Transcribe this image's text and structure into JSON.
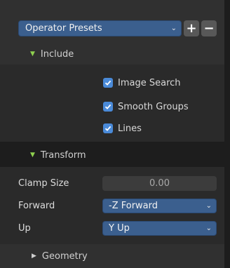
{
  "presets": {
    "label": "Operator Presets",
    "add": "+",
    "remove": "−"
  },
  "include": {
    "title": "Include",
    "options": [
      {
        "label": "Image Search",
        "checked": true
      },
      {
        "label": "Smooth Groups",
        "checked": true
      },
      {
        "label": "Lines",
        "checked": true
      }
    ]
  },
  "transform": {
    "title": "Transform",
    "clamp_label": "Clamp Size",
    "clamp_value": "0.00",
    "forward_label": "Forward",
    "forward_value": "-Z Forward",
    "up_label": "Up",
    "up_value": "Y Up"
  },
  "geometry": {
    "title": "Geometry"
  },
  "colors": {
    "accent": "#3b5f8e",
    "checkbox": "#4a8ad8",
    "expanded_arrow": "#8fd14f"
  }
}
